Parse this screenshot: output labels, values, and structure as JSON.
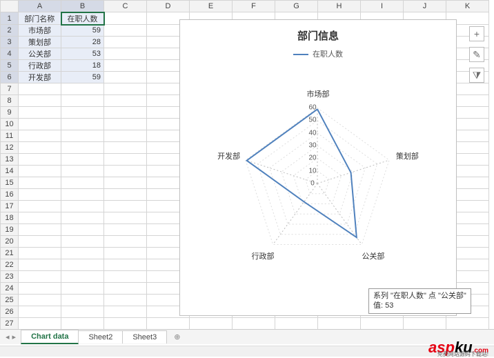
{
  "columns": [
    "A",
    "B",
    "C",
    "D",
    "E",
    "F",
    "G",
    "H",
    "I",
    "J",
    "K"
  ],
  "rows": 29,
  "data_table": {
    "headers": [
      "部门名称",
      "在职人数"
    ],
    "rows": [
      {
        "name": "市场部",
        "value": 59
      },
      {
        "name": "策划部",
        "value": 28
      },
      {
        "name": "公关部",
        "value": 53
      },
      {
        "name": "行政部",
        "value": 18
      },
      {
        "name": "开发部",
        "value": 59
      }
    ]
  },
  "chart_data": {
    "type": "radar",
    "title": "部门信息",
    "series": [
      {
        "name": "在职人数",
        "values": [
          59,
          28,
          53,
          18,
          59
        ]
      }
    ],
    "categories": [
      "市场部",
      "策划部",
      "公关部",
      "行政部",
      "开发部"
    ],
    "ticks": [
      0,
      10,
      20,
      30,
      40,
      50,
      60
    ],
    "max": 60,
    "legend_position": "top",
    "line_color": "#4f81bd"
  },
  "tooltip": {
    "line1": "系列 \"在职人数\" 点 \"公关部\"",
    "line2": "值: 53"
  },
  "side_buttons": [
    {
      "name": "plus-icon",
      "glyph": "+"
    },
    {
      "name": "brush-icon",
      "glyph": "✎"
    },
    {
      "name": "filter-icon",
      "glyph": "⧩"
    }
  ],
  "tabs": {
    "nav_prev": "◂",
    "nav_next": "▸",
    "items": [
      "Chart data",
      "Sheet2",
      "Sheet3"
    ],
    "active": 0,
    "add": "⊕"
  },
  "watermark": {
    "a": "asp",
    "b": "ku",
    "c": ".com",
    "sub": "免费网站源码下载站!"
  }
}
